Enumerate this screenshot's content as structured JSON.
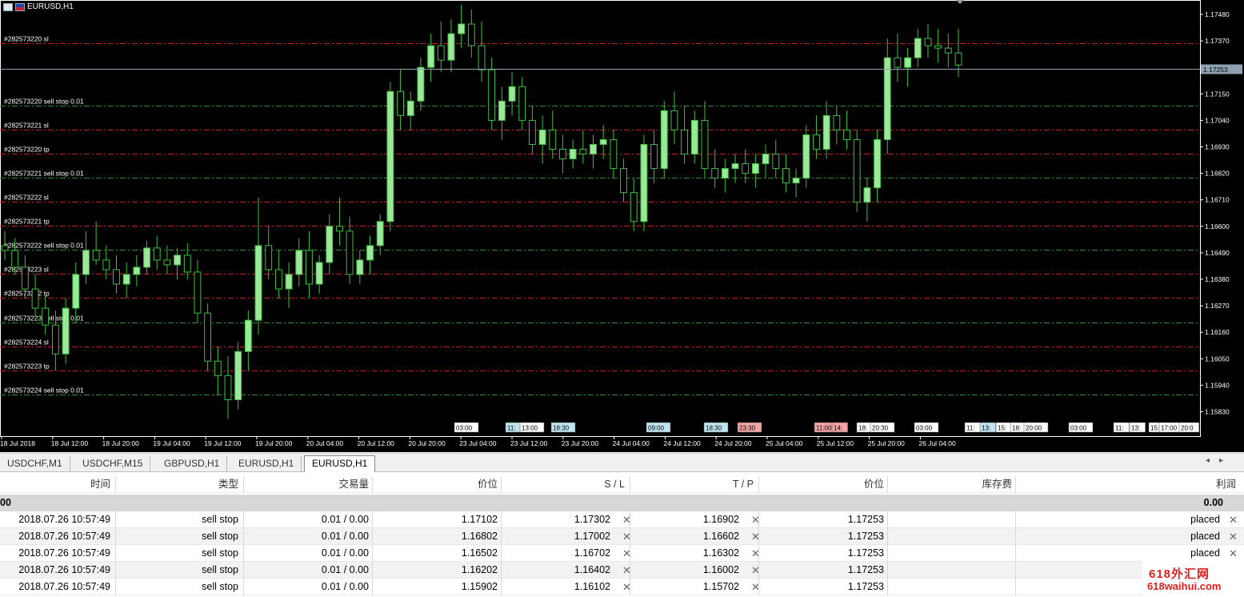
{
  "chart": {
    "title": "EURUSD,H1",
    "current_price": "1.17253",
    "price_ticks": [
      "1.17480",
      "1.17370",
      "1.17150",
      "1.17040",
      "1.16930",
      "1.16820",
      "1.16710",
      "1.16600",
      "1.16490",
      "1.16380",
      "1.16270",
      "1.16160",
      "1.16050",
      "1.15940",
      "1.15830"
    ],
    "time_labels": [
      "18 Jul 2018",
      "18 Jul 12:00",
      "18 Jul 20:00",
      "19 Jul 04:00",
      "19 Jul 12:00",
      "19 Jul 20:00",
      "20 Jul 04:00",
      "20 Jul 12:00",
      "20 Jul 20:00",
      "23 Jul 04:00",
      "23 Jul 12:00",
      "23 Jul 20:00",
      "24 Jul 04:00",
      "24 Jul 12:00",
      "24 Jul 20:00",
      "25 Jul 04:00",
      "25 Jul 12:00",
      "25 Jul 20:00",
      "26 Jul 04:00"
    ],
    "levels": [
      {
        "label": "#282573220 sl",
        "price": 1.1736,
        "color": "#c81e1e"
      },
      {
        "label": "#282573220 sell stop 0.01",
        "price": 1.17102,
        "color": "#2f8f2f"
      },
      {
        "label": "#282573221 sl",
        "price": 1.17002,
        "color": "#c81e1e"
      },
      {
        "label": "#282573220 tp",
        "price": 1.16902,
        "color": "#c81e1e"
      },
      {
        "label": "#282573221 sell stop 0.01",
        "price": 1.16802,
        "color": "#2f8f2f"
      },
      {
        "label": "#282573222 sl",
        "price": 1.16702,
        "color": "#c81e1e"
      },
      {
        "label": "#282573221 tp",
        "price": 1.16602,
        "color": "#c81e1e"
      },
      {
        "label": "#282573222 sell stop 0.01",
        "price": 1.16502,
        "color": "#2f8f2f"
      },
      {
        "label": "#282573223 sl",
        "price": 1.16402,
        "color": "#c81e1e"
      },
      {
        "label": "#282573222 tp",
        "price": 1.16302,
        "color": "#c81e1e"
      },
      {
        "label": "#282573223 sell stop 0.01",
        "price": 1.16202,
        "color": "#2f8f2f"
      },
      {
        "label": "#282573224 sl",
        "price": 1.16102,
        "color": "#c81e1e"
      },
      {
        "label": "#282573223 tp",
        "price": 1.16002,
        "color": "#c81e1e"
      },
      {
        "label": "#282573224 sell stop 0.01",
        "price": 1.15902,
        "color": "#2f8f2f"
      }
    ],
    "event_markers": [
      {
        "text": "03:00",
        "color": "#ffffff"
      },
      {
        "text": "11:",
        "color": "#bfe6f0"
      },
      {
        "text": "13:00",
        "color": "#ffffff"
      },
      {
        "text": "18:30",
        "color": "#bfe6f0"
      },
      {
        "text": "09:00",
        "color": "#bfe6f0"
      },
      {
        "text": "18:30",
        "color": "#bfe6f0"
      },
      {
        "text": "23:30",
        "color": "#f2a5a5"
      },
      {
        "text": "11:00",
        "color": "#f2a5a5"
      },
      {
        "text": "14:",
        "color": "#f2a5a5"
      },
      {
        "text": "18:",
        "color": "#ffffff"
      },
      {
        "text": "20:30",
        "color": "#ffffff"
      },
      {
        "text": "03:00",
        "color": "#ffffff"
      },
      {
        "text": "11:",
        "color": "#ffffff"
      },
      {
        "text": "13:",
        "color": "#bfe6f0"
      },
      {
        "text": "15:",
        "color": "#ffffff"
      },
      {
        "text": "18:",
        "color": "#ffffff"
      },
      {
        "text": "20:00",
        "color": "#ffffff"
      },
      {
        "text": "03:00",
        "color": "#ffffff"
      },
      {
        "text": "11:",
        "color": "#ffffff"
      },
      {
        "text": "13:",
        "color": "#ffffff"
      },
      {
        "text": "15:",
        "color": "#ffffff"
      },
      {
        "text": "17:00",
        "color": "#ffffff"
      },
      {
        "text": "20:0",
        "color": "#ffffff"
      }
    ],
    "colors": {
      "bull": "#9be89b",
      "bear": "#000000",
      "wick": "#3fbf3f",
      "grid_text": "#ffffff",
      "bid_line": "#8fa0b3"
    }
  },
  "tabs": [
    {
      "label": "USDCHF,M1"
    },
    {
      "label": "USDCHF,M15"
    },
    {
      "label": "GBPUSD,H1"
    },
    {
      "label": "EURUSD,H1"
    },
    {
      "label": "EURUSD,H1",
      "active": true
    }
  ],
  "table": {
    "headers": [
      "时间",
      "类型",
      "交易量",
      "价位",
      "S / L",
      "T / P",
      "价位",
      "库存费",
      "利润"
    ],
    "summary": {
      "left": "00",
      "right": "0.00"
    },
    "rows": [
      {
        "time": "2018.07.26 10:57:49",
        "type": "sell stop",
        "volume": "0.01 / 0.00",
        "price": "1.17102",
        "sl": "1.17302",
        "tp": "1.16902",
        "current": "1.17253",
        "swap": "",
        "profit": "placed"
      },
      {
        "time": "2018.07.26 10:57:49",
        "type": "sell stop",
        "volume": "0.01 / 0.00",
        "price": "1.16802",
        "sl": "1.17002",
        "tp": "1.16602",
        "current": "1.17253",
        "swap": "",
        "profit": "placed"
      },
      {
        "time": "2018.07.26 10:57:49",
        "type": "sell stop",
        "volume": "0.01 / 0.00",
        "price": "1.16502",
        "sl": "1.16702",
        "tp": "1.16302",
        "current": "1.17253",
        "swap": "",
        "profit": "placed"
      },
      {
        "time": "2018.07.26 10:57:49",
        "type": "sell stop",
        "volume": "0.01 / 0.00",
        "price": "1.16202",
        "sl": "1.16402",
        "tp": "1.16002",
        "current": "1.17253",
        "swap": "",
        "profit": ""
      },
      {
        "time": "2018.07.26 10:57:49",
        "type": "sell stop",
        "volume": "0.01 / 0.00",
        "price": "1.15902",
        "sl": "1.16102",
        "tp": "1.15702",
        "current": "1.17253",
        "swap": "",
        "profit": ""
      }
    ]
  },
  "watermark": {
    "line1": "618外汇网",
    "line2": "618waihui.com"
  },
  "chart_data": {
    "type": "candlestick",
    "title": "EURUSD,H1",
    "ylim": [
      1.1578,
      1.1752
    ],
    "candles": [
      [
        1.1652,
        1.1658,
        1.1646,
        1.165
      ],
      [
        1.165,
        1.1655,
        1.164,
        1.1643
      ],
      [
        1.1643,
        1.1648,
        1.163,
        1.1634
      ],
      [
        1.1634,
        1.164,
        1.1622,
        1.1626
      ],
      [
        1.1626,
        1.1631,
        1.1615,
        1.1619
      ],
      [
        1.1619,
        1.1625,
        1.16,
        1.1607
      ],
      [
        1.1607,
        1.163,
        1.1603,
        1.1626
      ],
      [
        1.1626,
        1.1645,
        1.162,
        1.164
      ],
      [
        1.164,
        1.1658,
        1.1636,
        1.165
      ],
      [
        1.165,
        1.1662,
        1.1644,
        1.1646
      ],
      [
        1.1646,
        1.1652,
        1.1638,
        1.1642
      ],
      [
        1.1642,
        1.1648,
        1.1632,
        1.1636
      ],
      [
        1.1636,
        1.1645,
        1.163,
        1.164
      ],
      [
        1.164,
        1.1648,
        1.1635,
        1.1643
      ],
      [
        1.1643,
        1.1654,
        1.164,
        1.1651
      ],
      [
        1.1651,
        1.1656,
        1.1642,
        1.1646
      ],
      [
        1.1646,
        1.1652,
        1.164,
        1.1644
      ],
      [
        1.1644,
        1.1651,
        1.1638,
        1.1648
      ],
      [
        1.1648,
        1.1653,
        1.1638,
        1.1641
      ],
      [
        1.1641,
        1.1646,
        1.162,
        1.1624
      ],
      [
        1.1624,
        1.1628,
        1.16,
        1.1604
      ],
      [
        1.1604,
        1.161,
        1.159,
        1.1598
      ],
      [
        1.1598,
        1.1606,
        1.158,
        1.1588
      ],
      [
        1.1588,
        1.1612,
        1.1584,
        1.1608
      ],
      [
        1.1608,
        1.1625,
        1.16,
        1.1621
      ],
      [
        1.1621,
        1.1672,
        1.1615,
        1.1652
      ],
      [
        1.1652,
        1.166,
        1.1638,
        1.1642
      ],
      [
        1.1642,
        1.165,
        1.163,
        1.1634
      ],
      [
        1.1634,
        1.1645,
        1.1626,
        1.164
      ],
      [
        1.164,
        1.1655,
        1.1635,
        1.165
      ],
      [
        1.165,
        1.1658,
        1.163,
        1.1636
      ],
      [
        1.1636,
        1.1648,
        1.1632,
        1.1645
      ],
      [
        1.1645,
        1.1665,
        1.164,
        1.166
      ],
      [
        1.166,
        1.1672,
        1.1652,
        1.1658
      ],
      [
        1.1658,
        1.1664,
        1.1636,
        1.164
      ],
      [
        1.164,
        1.165,
        1.1636,
        1.1646
      ],
      [
        1.1646,
        1.1656,
        1.164,
        1.1652
      ],
      [
        1.1652,
        1.1665,
        1.1648,
        1.1662
      ],
      [
        1.1662,
        1.172,
        1.1658,
        1.1716
      ],
      [
        1.1716,
        1.1725,
        1.17,
        1.1706
      ],
      [
        1.1706,
        1.1716,
        1.17,
        1.1712
      ],
      [
        1.1712,
        1.173,
        1.1708,
        1.1726
      ],
      [
        1.1726,
        1.174,
        1.172,
        1.1735
      ],
      [
        1.1735,
        1.1745,
        1.1724,
        1.1729
      ],
      [
        1.1729,
        1.1746,
        1.1724,
        1.174
      ],
      [
        1.174,
        1.1752,
        1.1734,
        1.1744
      ],
      [
        1.1744,
        1.175,
        1.173,
        1.1735
      ],
      [
        1.1735,
        1.1745,
        1.172,
        1.1725
      ],
      [
        1.1725,
        1.173,
        1.17,
        1.1704
      ],
      [
        1.1704,
        1.1718,
        1.1696,
        1.1712
      ],
      [
        1.1712,
        1.1724,
        1.1706,
        1.1718
      ],
      [
        1.1718,
        1.1722,
        1.17,
        1.1704
      ],
      [
        1.1704,
        1.171,
        1.169,
        1.1694
      ],
      [
        1.1694,
        1.1706,
        1.1686,
        1.17
      ],
      [
        1.17,
        1.1708,
        1.1688,
        1.1692
      ],
      [
        1.1692,
        1.1698,
        1.1682,
        1.1688
      ],
      [
        1.1688,
        1.1696,
        1.1684,
        1.1692
      ],
      [
        1.1692,
        1.17,
        1.1686,
        1.169
      ],
      [
        1.169,
        1.1698,
        1.1684,
        1.1694
      ],
      [
        1.1694,
        1.1702,
        1.1688,
        1.1696
      ],
      [
        1.1696,
        1.17,
        1.168,
        1.1684
      ],
      [
        1.1684,
        1.1688,
        1.167,
        1.1674
      ],
      [
        1.1674,
        1.168,
        1.1658,
        1.1662
      ],
      [
        1.1662,
        1.1698,
        1.1658,
        1.1694
      ],
      [
        1.1694,
        1.17,
        1.1678,
        1.1684
      ],
      [
        1.1684,
        1.1712,
        1.168,
        1.1708
      ],
      [
        1.1708,
        1.1716,
        1.1694,
        1.17
      ],
      [
        1.17,
        1.171,
        1.1686,
        1.169
      ],
      [
        1.169,
        1.1708,
        1.1686,
        1.1704
      ],
      [
        1.1704,
        1.1712,
        1.168,
        1.1684
      ],
      [
        1.1684,
        1.1692,
        1.1676,
        1.168
      ],
      [
        1.168,
        1.1688,
        1.1674,
        1.1684
      ],
      [
        1.1684,
        1.169,
        1.1678,
        1.1686
      ],
      [
        1.1686,
        1.1692,
        1.1678,
        1.1682
      ],
      [
        1.1682,
        1.169,
        1.1676,
        1.1686
      ],
      [
        1.1686,
        1.1694,
        1.168,
        1.169
      ],
      [
        1.169,
        1.1696,
        1.168,
        1.1684
      ],
      [
        1.1684,
        1.169,
        1.1674,
        1.1678
      ],
      [
        1.1678,
        1.1684,
        1.1672,
        1.168
      ],
      [
        1.168,
        1.1702,
        1.1676,
        1.1698
      ],
      [
        1.1698,
        1.1706,
        1.1688,
        1.1692
      ],
      [
        1.1692,
        1.1712,
        1.1688,
        1.1706
      ],
      [
        1.1706,
        1.171,
        1.1694,
        1.17
      ],
      [
        1.17,
        1.1708,
        1.1692,
        1.1696
      ],
      [
        1.1696,
        1.17,
        1.1666,
        1.167
      ],
      [
        1.167,
        1.168,
        1.1662,
        1.1676
      ],
      [
        1.1676,
        1.17,
        1.167,
        1.1696
      ],
      [
        1.1696,
        1.1738,
        1.169,
        1.173
      ],
      [
        1.173,
        1.174,
        1.172,
        1.1726
      ],
      [
        1.1726,
        1.1734,
        1.1718,
        1.173
      ],
      [
        1.173,
        1.1742,
        1.1726,
        1.1738
      ],
      [
        1.1738,
        1.1744,
        1.173,
        1.1735
      ],
      [
        1.1735,
        1.1742,
        1.1728,
        1.1734
      ],
      [
        1.1734,
        1.174,
        1.1726,
        1.1732
      ],
      [
        1.1732,
        1.1742,
        1.1722,
        1.1727
      ]
    ]
  }
}
